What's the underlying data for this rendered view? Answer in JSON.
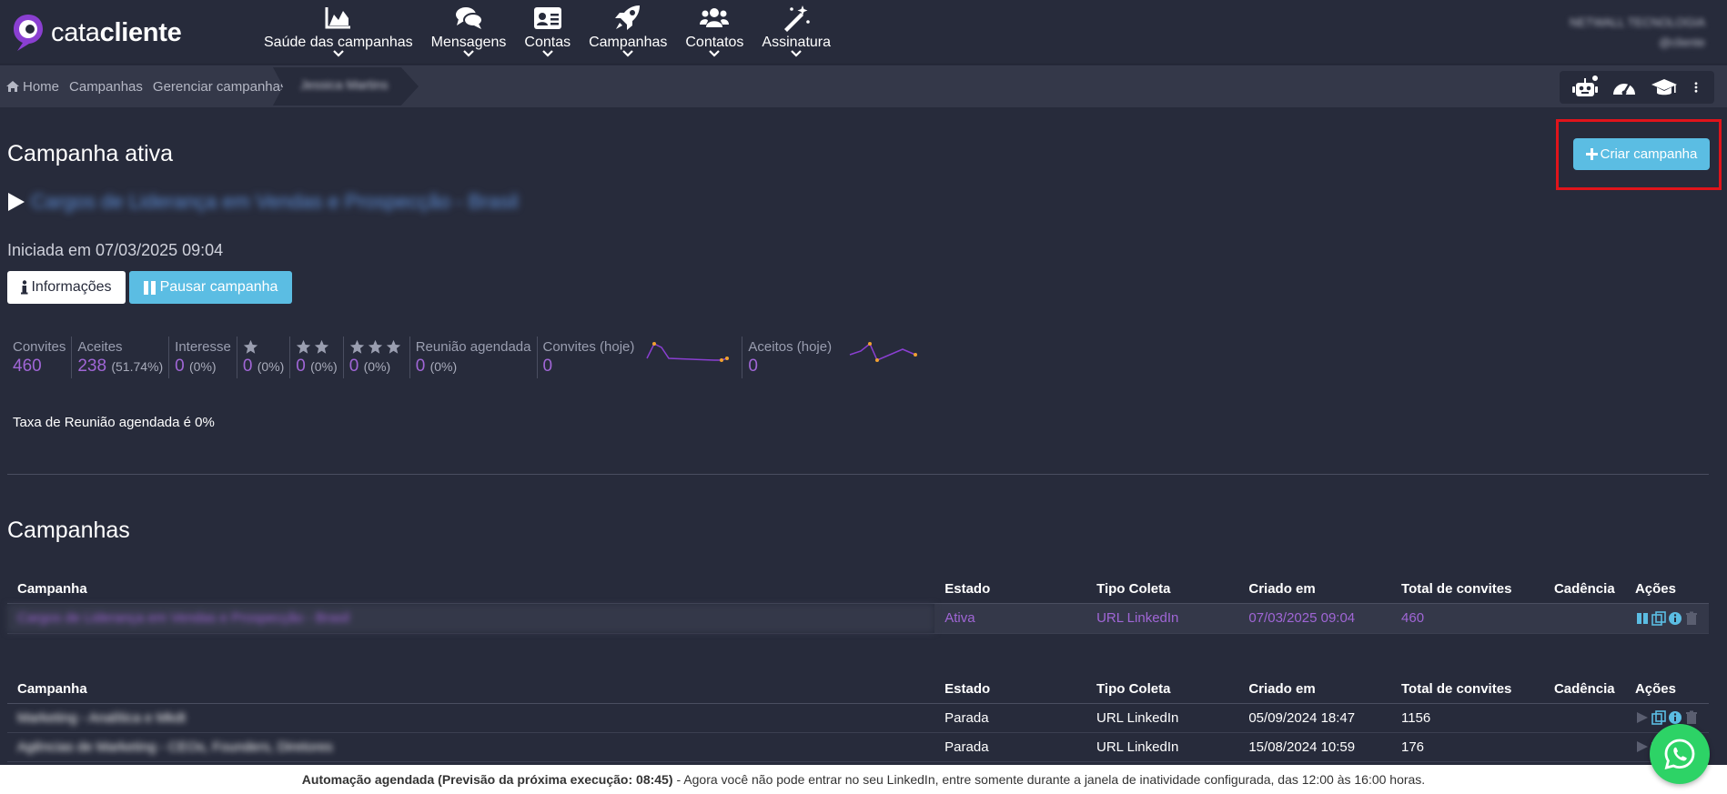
{
  "brand": {
    "name_light": "cata",
    "name_bold": "cliente"
  },
  "nav": {
    "items": [
      {
        "label": "Saúde das campanhas",
        "icon": "area-chart-icon"
      },
      {
        "label": "Mensagens",
        "icon": "comments-icon"
      },
      {
        "label": "Contas",
        "icon": "id-card-icon"
      },
      {
        "label": "Campanhas",
        "icon": "rocket-icon"
      },
      {
        "label": "Contatos",
        "icon": "users-icon"
      },
      {
        "label": "Assinatura",
        "icon": "magic-wand-icon"
      }
    ],
    "user_line1": "NETWALL TECNOLOGIA",
    "user_line2": "@cliente"
  },
  "breadcrumb": {
    "home": "Home",
    "campaigns": "Campanhas",
    "manage": "Gerenciar campanhas",
    "current": "Jessica Martins"
  },
  "toolbar": {
    "icons": [
      "robot-icon",
      "dashboard-icon",
      "graduation-cap-icon",
      "more-vertical-icon"
    ]
  },
  "active": {
    "title": "Campanha ativa",
    "create_label": "Criar campanha",
    "campaign_name": "Cargos de Liderança em Vendas e Prospecção - Brasil",
    "started": "Iniciada em 07/03/2025 09:04",
    "info_label": "Informações",
    "pause_label": "Pausar campanha",
    "taxa": "Taxa de Reunião agendada é 0%"
  },
  "stats": {
    "convites": {
      "label": "Convites",
      "value": "460"
    },
    "aceites": {
      "label": "Aceites",
      "value": "238",
      "pct": "(51.74%)"
    },
    "interesse": {
      "label": "Interesse",
      "value": "0",
      "pct": "(0%)"
    },
    "star1": {
      "value": "0",
      "pct": "(0%)"
    },
    "star2": {
      "value": "0",
      "pct": "(0%)"
    },
    "star3": {
      "value": "0",
      "pct": "(0%)"
    },
    "reuniao": {
      "label": "Reunião agendada",
      "value": "0",
      "pct": "(0%)"
    },
    "convites_hoje": {
      "label": "Convites (hoje)",
      "value": "0"
    },
    "aceitos_hoje": {
      "label": "Aceitos (hoje)",
      "value": "0"
    }
  },
  "campaigns": {
    "title": "Campanhas",
    "headers": {
      "campanha": "Campanha",
      "estado": "Estado",
      "tipo": "Tipo Coleta",
      "criado": "Criado em",
      "total": "Total de convites",
      "cadencia": "Cadência",
      "acoes": "Ações"
    },
    "active_row": {
      "campanha": "Cargos de Liderança em Vendas e Prospecção - Brasil",
      "estado": "Ativa",
      "tipo": "URL LinkedIn",
      "criado": "07/03/2025 09:04",
      "total": "460",
      "cadencia": ""
    },
    "rows": [
      {
        "campanha": "Marketing - Analítica e Mkdt",
        "estado": "Parada",
        "tipo": "URL LinkedIn",
        "criado": "05/09/2024 18:47",
        "total": "1156",
        "cadencia": ""
      },
      {
        "campanha": "Agências de Marketing - CEOs, Founders, Diretores",
        "estado": "Parada",
        "tipo": "URL LinkedIn",
        "criado": "15/08/2024 10:59",
        "total": "176",
        "cadencia": ""
      }
    ]
  },
  "footer": {
    "bold": "Automação agendada (Previsão da próxima execução: 08:45)",
    "text": "- Agora você não pode entrar no seu LinkedIn, entre somente durante a janela de inatividade configurada, das 12:00 às 16:00 horas."
  },
  "colors": {
    "bg": "#272b3b",
    "accent": "#5bbde3",
    "purple": "#a066d6",
    "highlight": "#e0141b",
    "whatsapp": "#2dd366"
  }
}
